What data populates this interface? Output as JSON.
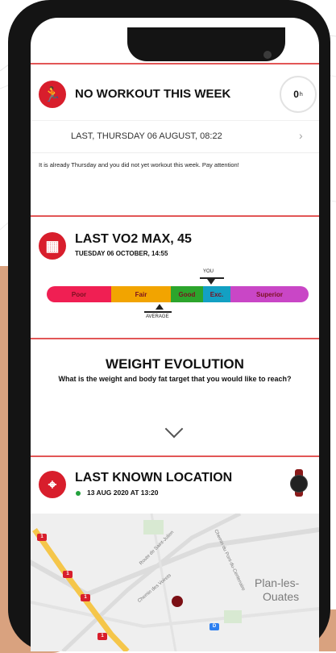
{
  "workout_card": {
    "title": "NO WORKOUT THIS WEEK",
    "progress_value": "0",
    "progress_unit": "h",
    "last_workout_date": "LAST, THURSDAY 06 AUGUST, 08:22",
    "message": "It is already Thursday and you did not yet workout this week. Pay attention!"
  },
  "vo2_card": {
    "title": "LAST VO2 MAX, 45",
    "date": "TUESDAY 06 OCTOBER, 14:55",
    "you_label": "YOU",
    "average_label": "AVERAGE",
    "segments": [
      {
        "label": "Poor",
        "color": "#f01f53"
      },
      {
        "label": "Fair",
        "color": "#f2a400"
      },
      {
        "label": "Good",
        "color": "#2ca52c"
      },
      {
        "label": "Exc.",
        "color": "#13a0c3"
      },
      {
        "label": "Superior",
        "color": "#c946c6"
      }
    ]
  },
  "weight_card": {
    "title": "WEIGHT EVOLUTION",
    "subtitle": "What is the weight and body fat target that you would like to reach?"
  },
  "location_card": {
    "title": "LAST KNOWN LOCATION",
    "date": "13 AUG 2020 AT 13:20",
    "status_color": "#23a13d"
  },
  "map": {
    "place_name": "Plan-les-Ouates",
    "place_line1": "Plan-les-",
    "place_line2": "Ouates",
    "roads": [
      "Route de Saint-Julien",
      "Chemin des Voirets",
      "Chemin du Pont-du-Centenaire"
    ],
    "markers": [
      "1",
      "1",
      "1",
      "1"
    ],
    "transit_marker": "D"
  },
  "colors": {
    "accent": "#d81e2c",
    "divider": "#e25656"
  }
}
